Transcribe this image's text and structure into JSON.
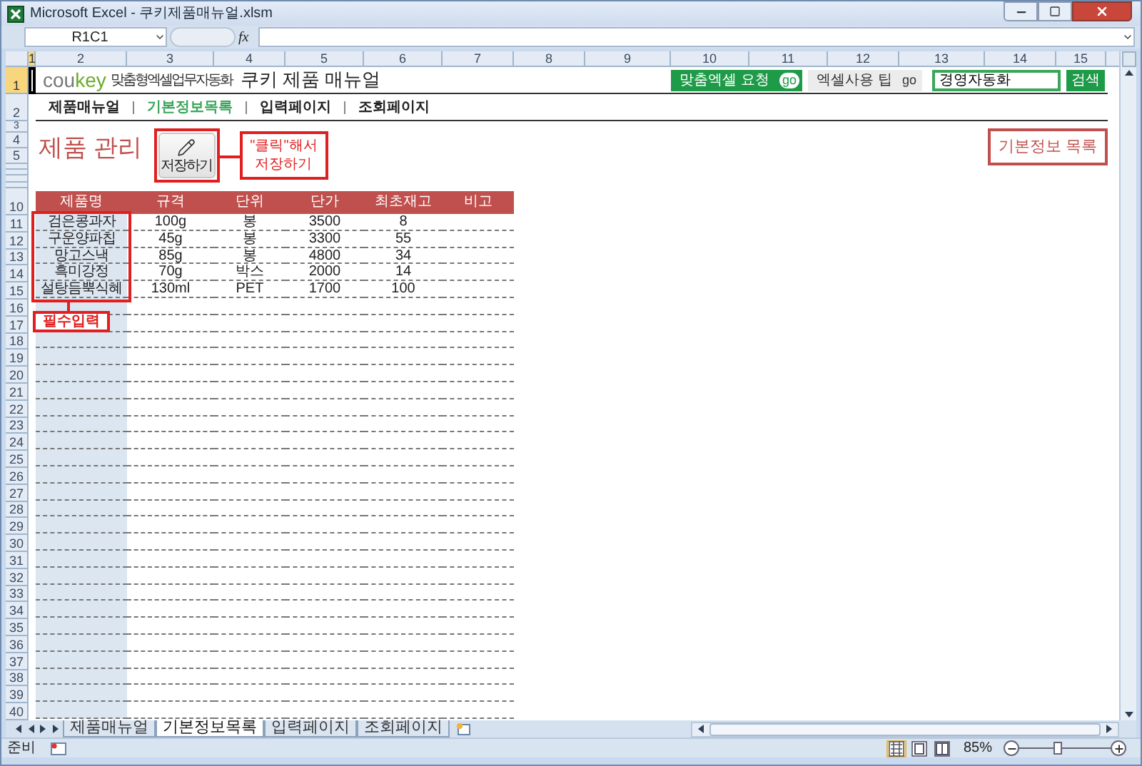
{
  "window": {
    "title": "Microsoft Excel - 쿠키제품매뉴얼.xlsm"
  },
  "formula_bar": {
    "name_box": "R1C1",
    "function_label": "fx"
  },
  "column_headers": [
    {
      "label": "1",
      "selected": true
    },
    {
      "label": "2",
      "selected": false
    },
    {
      "label": "3",
      "selected": false
    },
    {
      "label": "4",
      "selected": false
    },
    {
      "label": "5",
      "selected": false
    },
    {
      "label": "6",
      "selected": false
    },
    {
      "label": "7",
      "selected": false
    },
    {
      "label": "8",
      "selected": false
    },
    {
      "label": "9",
      "selected": false
    },
    {
      "label": "10",
      "selected": false
    },
    {
      "label": "11",
      "selected": false
    },
    {
      "label": "12",
      "selected": false
    },
    {
      "label": "13",
      "selected": false
    },
    {
      "label": "14",
      "selected": false
    },
    {
      "label": "15",
      "selected": false
    }
  ],
  "row_headers": [
    {
      "label": "1",
      "selected": true
    },
    {
      "label": "2",
      "selected": false
    },
    {
      "label": "3",
      "selected": false
    },
    {
      "label": "4",
      "selected": false
    },
    {
      "label": "5",
      "selected": false
    },
    {
      "label": "10",
      "selected": false
    },
    {
      "label": "11",
      "selected": false
    },
    {
      "label": "12",
      "selected": false
    },
    {
      "label": "13",
      "selected": false
    },
    {
      "label": "14",
      "selected": false
    },
    {
      "label": "15",
      "selected": false
    },
    {
      "label": "16",
      "selected": false
    },
    {
      "label": "17",
      "selected": false
    },
    {
      "label": "18",
      "selected": false
    },
    {
      "label": "19",
      "selected": false
    },
    {
      "label": "20",
      "selected": false
    },
    {
      "label": "21",
      "selected": false
    },
    {
      "label": "22",
      "selected": false
    },
    {
      "label": "23",
      "selected": false
    },
    {
      "label": "24",
      "selected": false
    },
    {
      "label": "25",
      "selected": false
    },
    {
      "label": "26",
      "selected": false
    },
    {
      "label": "27",
      "selected": false
    },
    {
      "label": "28",
      "selected": false
    },
    {
      "label": "29",
      "selected": false
    },
    {
      "label": "30",
      "selected": false
    },
    {
      "label": "31",
      "selected": false
    },
    {
      "label": "32",
      "selected": false
    },
    {
      "label": "33",
      "selected": false
    },
    {
      "label": "34",
      "selected": false
    },
    {
      "label": "35",
      "selected": false
    },
    {
      "label": "36",
      "selected": false
    },
    {
      "label": "37",
      "selected": false
    },
    {
      "label": "38",
      "selected": false
    },
    {
      "label": "39",
      "selected": false
    },
    {
      "label": "40",
      "selected": false
    }
  ],
  "header": {
    "logo_left": "cou",
    "logo_right": "key",
    "tagline": "맞춤형엑셀업무자동화",
    "title": "쿠키 제품 매뉴얼"
  },
  "links": [
    {
      "label": "맞춤엑셀 요청",
      "badge": "go",
      "kind": "primary"
    },
    {
      "label": "엑셀사용 팁",
      "badge": "go",
      "kind": "secondary"
    }
  ],
  "search": {
    "value": "경영자동화",
    "button": "검색"
  },
  "nav": [
    {
      "label": "제품매뉴얼",
      "selected": false
    },
    {
      "label": "기본정보목록",
      "selected": true
    },
    {
      "label": "입력페이지",
      "selected": false
    },
    {
      "label": "조회페이지",
      "selected": false
    }
  ],
  "page_title": "제품 관리",
  "save_button": "저장하기",
  "save_callout": "\"클릭\"해서 저장하기",
  "list_label": "기본정보 목록",
  "table": {
    "columns": [
      "제품명",
      "규격",
      "단위",
      "단가",
      "최초재고",
      "비고"
    ],
    "rows": [
      [
        "검은콩과자",
        "100g",
        "봉",
        "3500",
        "8"
      ],
      [
        "구운양파칩",
        "45g",
        "봉",
        "3300",
        "55"
      ],
      [
        "망고스낵",
        "85g",
        "봉",
        "4800",
        "34"
      ],
      [
        "흑미강정",
        "70g",
        "박스",
        "2000",
        "14"
      ],
      [
        "설탕듬뿍식혜",
        "130ml",
        "PET",
        "1700",
        "100"
      ]
    ]
  },
  "required_callout": "필수입력",
  "sheet_tabs": [
    {
      "label": "제품매뉴얼",
      "selected": false
    },
    {
      "label": "기본정보목록",
      "selected": true
    },
    {
      "label": "입력페이지",
      "selected": false
    },
    {
      "label": "조회페이지",
      "selected": false
    }
  ],
  "status_bar": {
    "status": "준비",
    "views": [
      {
        "kind": "normal",
        "selected": true
      },
      {
        "kind": "page_layout",
        "selected": false
      },
      {
        "kind": "page_break",
        "selected": false
      }
    ],
    "zoom": "85%",
    "zoom_slider": {
      "level": 0.42
    }
  }
}
